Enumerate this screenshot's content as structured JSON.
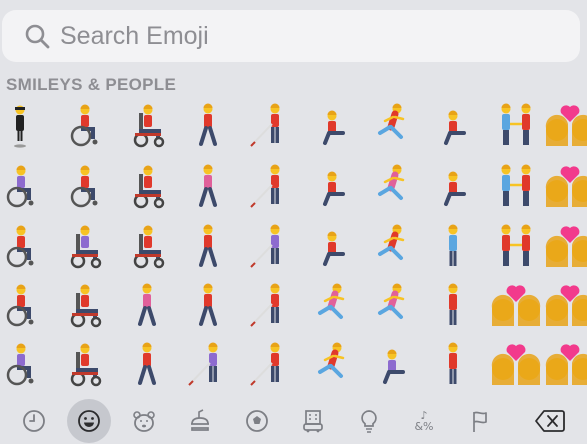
{
  "search": {
    "placeholder": "Search Emoji"
  },
  "section": {
    "title": "SMILEYS & PEOPLE"
  },
  "grid": {
    "rows": [
      [
        "person-in-suit-levitating",
        "person-in-manual-wheelchair",
        "person-in-motorized-wheelchair",
        "person-walking",
        "person-with-white-cane",
        "person-kneeling",
        "person-running",
        "person-kneeling",
        "women-holding-hands",
        "couple-with-heart"
      ],
      [
        "woman-in-manual-wheelchair",
        "man-in-manual-wheelchair",
        "person-in-motorized-wheelchair",
        "woman-walking",
        "man-with-white-cane",
        "person-kneeling",
        "woman-running",
        "man-kneeling",
        "women-holding-hands",
        "couple-with-heart"
      ],
      [
        "person-in-manual-wheelchair",
        "woman-in-motorized-wheelchair",
        "man-in-motorized-wheelchair",
        "man-walking",
        "woman-with-white-cane",
        "man-kneeling",
        "man-running",
        "woman-standing",
        "men-holding-hands",
        "couple-with-heart"
      ],
      [
        "man-in-manual-wheelchair",
        "person-in-motorized-wheelchair",
        "woman-walking",
        "man-walking",
        "person-with-white-cane",
        "woman-running",
        "woman-running",
        "man-standing",
        "couple-with-heart",
        "couple-with-heart"
      ],
      [
        "woman-in-manual-wheelchair",
        "man-in-motorized-wheelchair",
        "person-walking",
        "woman-with-white-cane",
        "man-with-white-cane",
        "man-running",
        "woman-kneeling",
        "man-standing",
        "couple-with-heart",
        "couple-with-heart"
      ]
    ]
  },
  "tabbar": {
    "tabs": [
      "recent-icon",
      "smileys-people-icon",
      "animals-nature-icon",
      "food-drink-icon",
      "activity-icon",
      "travel-places-icon",
      "objects-icon",
      "symbols-icon",
      "flags-icon",
      "delete-icon"
    ],
    "symbols_line1": "♪",
    "symbols_line2": "&%",
    "selected": "smileys-people-icon"
  },
  "colors": {
    "skin": "#f7c324",
    "hair": "#e8a317",
    "pants": "#3d4a6b",
    "shirt_red": "#e0392b",
    "shirt_purple": "#8d6bcf",
    "shirt_pink": "#e0609a",
    "shirt_blue": "#5aa6e0",
    "heart": "#f23a8c",
    "icon_gray": "#7d7f85"
  }
}
